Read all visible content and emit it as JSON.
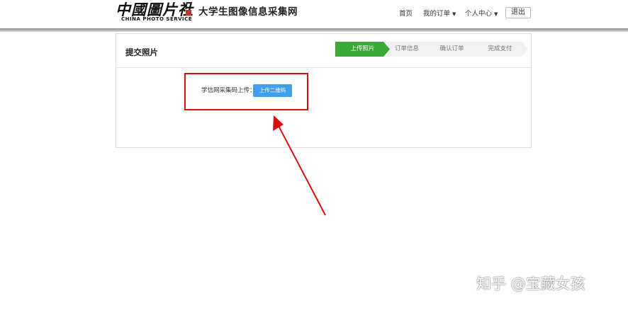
{
  "header": {
    "logo_cn": "中國圖片社",
    "logo_en": "CHINA PHOTO SERVICE",
    "site_title": "大学生图像信息采集网",
    "nav": {
      "home": "首页",
      "orders": "我的订单",
      "user_center": "个人中心",
      "logout": "退出"
    }
  },
  "panel": {
    "title": "提交照片",
    "steps": [
      "上传照片",
      "订单信息",
      "确认订单",
      "完成支付"
    ],
    "active_step": 0,
    "upload_label": "学信网采集码上传：",
    "upload_button": "上传二维码"
  },
  "annotation": {
    "box_color": "#d60f0f",
    "arrow_color": "#d60f0f"
  },
  "watermark": "知乎 @宝藏女孩",
  "colors": {
    "step_active": "#3aa935",
    "step_inactive": "#f1f1f1",
    "button_blue": "#3f9fe8"
  }
}
